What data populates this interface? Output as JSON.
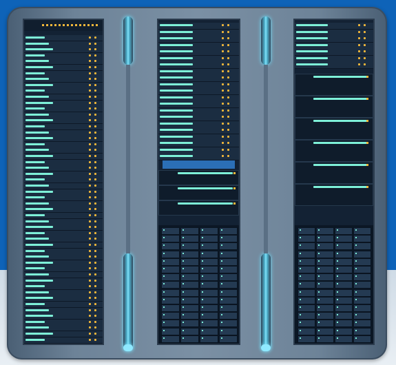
{
  "scene": {
    "colors": {
      "wall": "#0e63b8",
      "floor": "#e9eff4",
      "frame": "#6d8398",
      "rack": "#132234",
      "unit": "#1b2d41",
      "accent_bar": "#7ef0d8",
      "status_led": "#f3b83a",
      "light_strip": "#8fe9ff"
    },
    "icons": [
      "server-rack-icon",
      "light-strip-icon",
      "status-led-icon",
      "drive-bay-icon"
    ]
  }
}
